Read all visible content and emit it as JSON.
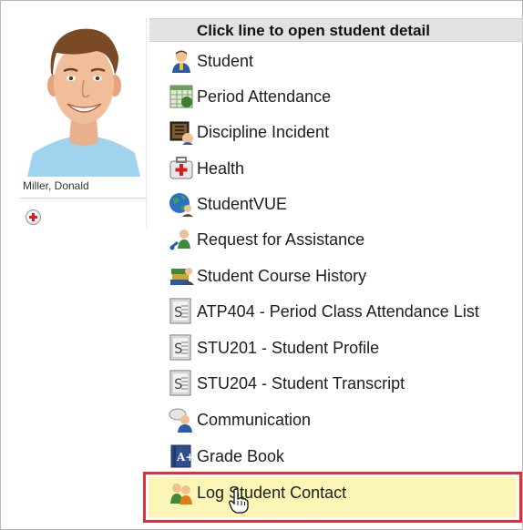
{
  "menu": {
    "header": "Click line to open student detail",
    "items": [
      {
        "label": "Student",
        "icon": "student-icon"
      },
      {
        "label": "Period Attendance",
        "icon": "calendar-icon"
      },
      {
        "label": "Discipline Incident",
        "icon": "discipline-book-icon"
      },
      {
        "label": "Health",
        "icon": "first-aid-kit-icon"
      },
      {
        "label": "StudentVUE",
        "icon": "globe-person-icon"
      },
      {
        "label": "Request for Assistance",
        "icon": "assistance-person-icon"
      },
      {
        "label": "Student Course History",
        "icon": "books-stack-icon"
      },
      {
        "label": "ATP404 - Period Class Attendance List",
        "icon": "report-document-icon"
      },
      {
        "label": "STU201 - Student Profile",
        "icon": "report-document-icon"
      },
      {
        "label": "STU204 - Student Transcript",
        "icon": "report-document-icon"
      },
      {
        "label": "Communication",
        "icon": "communication-person-icon"
      },
      {
        "label": "Grade Book",
        "icon": "grade-book-icon"
      },
      {
        "label": "Log Student Contact",
        "icon": "contact-people-icon",
        "highlighted": true
      }
    ]
  },
  "student": {
    "name": "Miller, Donald",
    "add_icon": "add-icon"
  },
  "colors": {
    "highlight_border": "#e0303a",
    "highlight_fill": "#fbf6b5"
  }
}
